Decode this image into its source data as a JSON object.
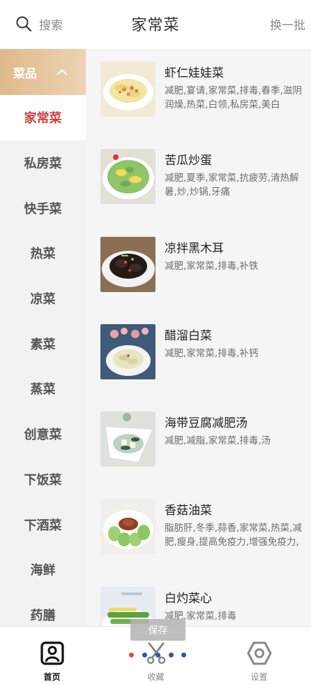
{
  "header": {
    "search_label": "搜索",
    "title": "家常菜",
    "refresh_label": "换一批"
  },
  "sidebar": {
    "group_label": "菜品",
    "items": [
      {
        "label": "家常菜",
        "active": true
      },
      {
        "label": "私房菜"
      },
      {
        "label": "快手菜"
      },
      {
        "label": "热菜"
      },
      {
        "label": "凉菜"
      },
      {
        "label": "素菜"
      },
      {
        "label": "蒸菜"
      },
      {
        "label": "创意菜"
      },
      {
        "label": "下饭菜"
      },
      {
        "label": "下酒菜"
      },
      {
        "label": "海鲜"
      },
      {
        "label": "药膳"
      }
    ]
  },
  "recipes": [
    {
      "name": "虾仁娃娃菜",
      "tags": "减肥,宴请,家常菜,排毒,春季,滋阴润燥,热菜,白领,私房菜,美白"
    },
    {
      "name": "苦瓜炒蛋",
      "tags": "减肥,夏季,家常菜,抗疲劳,清热解暑,炒,炒锅,牙痛"
    },
    {
      "name": "凉拌黑木耳",
      "tags": "减肥,家常菜,排毒,补铁"
    },
    {
      "name": "醋溜白菜",
      "tags": "减肥,家常菜,排毒,补钙"
    },
    {
      "name": "海带豆腐减肥汤",
      "tags": "减肥,减脂,家常菜,排毒,汤"
    },
    {
      "name": "香菇油菜",
      "tags": "脂肪肝,冬季,蒜香,家常菜,热菜,减肥,瘦身,提高免疫力,增强免疫力,"
    },
    {
      "name": "白灼菜心",
      "tags": "减肥,家常菜,排毒"
    }
  ],
  "bottom_nav": [
    {
      "label": "首页",
      "icon": "home-icon",
      "active": true
    },
    {
      "label": "收藏",
      "icon": "favorites-icon"
    },
    {
      "label": "设置",
      "icon": "settings-icon"
    }
  ],
  "overlay": {
    "save_label": "保存"
  },
  "colors": {
    "accent": "#d0403e",
    "category_header_start": "#e0b98b",
    "category_header_end": "#ecd3b3",
    "sidebar_bg": "#f2f2f2",
    "list_bg": "#f5f5f5"
  }
}
